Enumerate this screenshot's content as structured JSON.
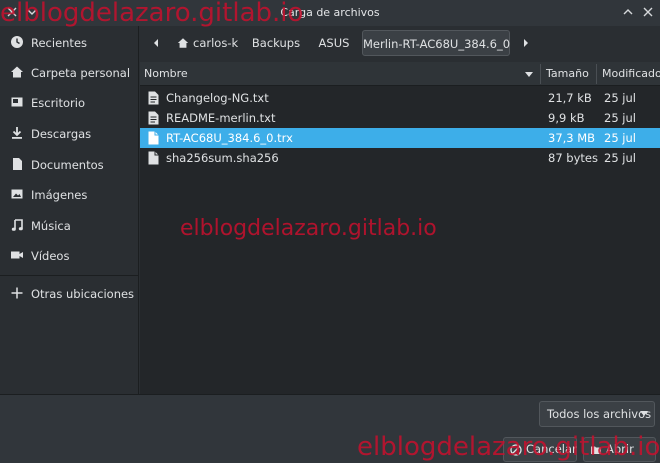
{
  "window": {
    "title": "Carga de archivos"
  },
  "sidebar": {
    "items": [
      {
        "label": "Recientes",
        "icon": "clock-icon"
      },
      {
        "label": "Carpeta personal",
        "icon": "home-icon"
      },
      {
        "label": "Escritorio",
        "icon": "desktop-icon"
      },
      {
        "label": "Descargas",
        "icon": "download-icon"
      },
      {
        "label": "Documentos",
        "icon": "document-icon"
      },
      {
        "label": "Imágenes",
        "icon": "image-icon"
      },
      {
        "label": "Música",
        "icon": "music-icon"
      },
      {
        "label": "Vídeos",
        "icon": "video-icon"
      }
    ],
    "other_locations": {
      "label": "Otras ubicaciones",
      "icon": "plus-icon"
    }
  },
  "pathbar": {
    "crumbs": [
      "carlos-k",
      "Backups",
      "ASUS",
      "Merlin-RT-AC68U_384.6_0"
    ],
    "active_index": 3
  },
  "filelist": {
    "columns": {
      "name": "Nombre",
      "size": "Tamaño",
      "modified": "Modificado"
    },
    "rows": [
      {
        "name": "Changelog-NG.txt",
        "size": "21,7 kB",
        "modified": "25 jul",
        "selected": false
      },
      {
        "name": "README-merlin.txt",
        "size": "9,9 kB",
        "modified": "25 jul",
        "selected": false
      },
      {
        "name": "RT-AC68U_384.6_0.trx",
        "size": "37,3 MB",
        "modified": "25 jul",
        "selected": true
      },
      {
        "name": "sha256sum.sha256",
        "size": "87 bytes",
        "modified": "25 jul",
        "selected": false
      }
    ]
  },
  "bottom": {
    "filter_label": "Todos los archivos",
    "cancel_label": "Cancelar",
    "open_label": "Abrir"
  },
  "watermark": {
    "text": "elblogdelazaro.gitlab.io"
  },
  "colors": {
    "accent": "#3daee9",
    "watermark": "#c8102e"
  }
}
